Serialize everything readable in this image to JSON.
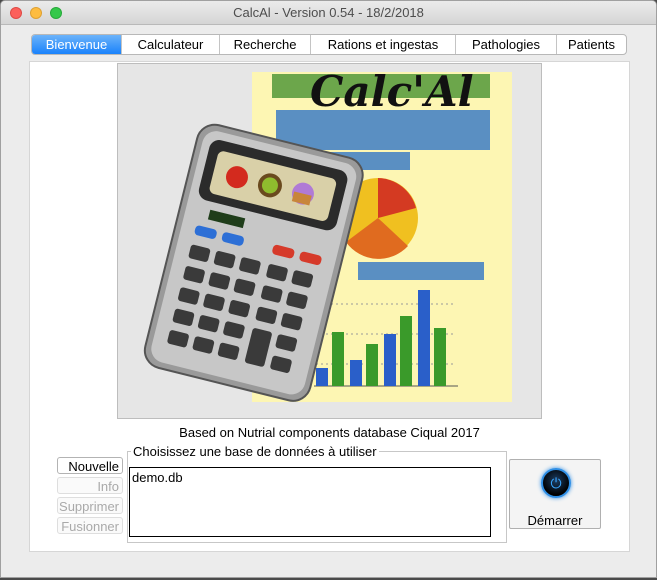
{
  "window": {
    "title": "CalcAl - Version 0.54 - 18/2/2018"
  },
  "tabs": [
    {
      "label": "Bienvenue",
      "active": true
    },
    {
      "label": "Calculateur",
      "active": false
    },
    {
      "label": "Recherche",
      "active": false
    },
    {
      "label": "Rations et ingestas",
      "active": false
    },
    {
      "label": "Pathologies",
      "active": false
    },
    {
      "label": "Patients",
      "active": false
    }
  ],
  "logo": {
    "text": "Calc'Al"
  },
  "credit": "Based on Nutrial components database Ciqual 2017",
  "database": {
    "group_label": "Choisissez une base de données à utiliser",
    "items": [
      "demo.db"
    ]
  },
  "side_buttons": {
    "new": "Nouvelle",
    "info": "Info",
    "delete": "Supprimer",
    "merge": "Fusionner"
  },
  "start": {
    "label": "Démarrer",
    "icon": "power-icon"
  },
  "colors": {
    "accent": "#1a82fb",
    "power_ring": "#2f8fe6"
  }
}
